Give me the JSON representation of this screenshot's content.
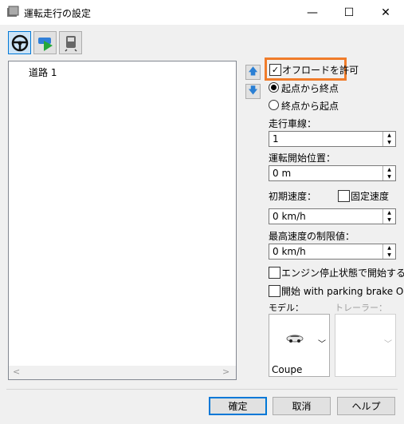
{
  "window": {
    "title": "運転走行の設定",
    "minimize": "—",
    "maximize": "☐",
    "close": "✕"
  },
  "toolbar": {
    "icons": [
      "steering-wheel-icon",
      "car-play-icon",
      "train-icon"
    ]
  },
  "tree": {
    "items": [
      "道路 1"
    ]
  },
  "scroll": {
    "left": "<",
    "right": ">"
  },
  "options": {
    "allow_offroad": {
      "label": "オフロードを許可",
      "checked": true
    },
    "start_to_end": {
      "label": "起点から終点",
      "selected": true
    },
    "end_to_start": {
      "label": "終点から起点",
      "selected": false
    },
    "lane_label": "走行車線：",
    "lane_value": "1",
    "start_pos_label": "運転開始位置：",
    "start_pos_value": "0 m",
    "init_speed_label": "初期速度：",
    "fixed_speed_label": "固定速度",
    "init_speed_value": "0 km/h",
    "max_speed_label": "最高速度の制限値：",
    "max_speed_value": "0 km/h",
    "engine_stop_label": "エンジン停止状態で開始する",
    "parking_brake_label": "開始 with parking brake ON"
  },
  "model": {
    "label": "モデル：",
    "value": "Coupe"
  },
  "trailer": {
    "label": "トレーラー："
  },
  "buttons": {
    "ok": "確定",
    "cancel": "取消",
    "help": "ヘルプ"
  },
  "colors": {
    "highlight": "#f07c2a",
    "accent": "#0078d7"
  }
}
